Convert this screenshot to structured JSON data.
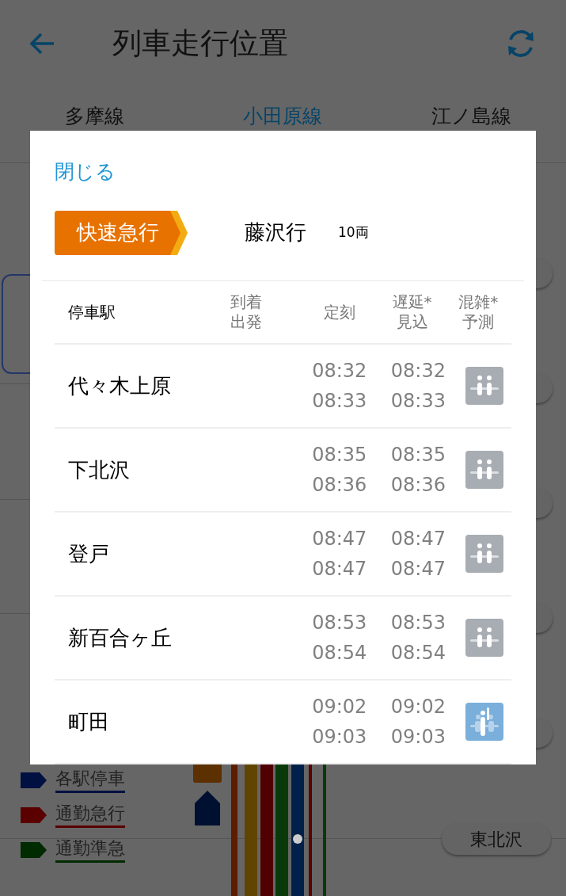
{
  "app_bar": {
    "title": "列車走行位置"
  },
  "tabs": [
    {
      "label": "多摩線",
      "selected": false
    },
    {
      "label": "小田原線",
      "selected": true
    },
    {
      "label": "江ノ島線",
      "selected": false
    }
  ],
  "map": {
    "legend": [
      {
        "label": "各駅停車",
        "color": "#001040"
      },
      {
        "label": "通勤急行",
        "color": "#5a0000"
      },
      {
        "label": "通勤準急",
        "color": "#002a00"
      }
    ],
    "station": "東北沢"
  },
  "dialog": {
    "close": "閉じる",
    "train_type": "快速急行",
    "destination": "藤沢行",
    "cars": "10両",
    "columns": [
      "停車駅",
      "到着出発",
      "定刻",
      "遅延*\n見込",
      "混雑*\n予測"
    ],
    "stops": [
      {
        "station": "代々木上原",
        "scheduled": [
          "08:32",
          "08:33"
        ],
        "expected": [
          "08:32",
          "08:33"
        ],
        "kind": "low"
      },
      {
        "station": "下北沢",
        "scheduled": [
          "08:35",
          "08:36"
        ],
        "expected": [
          "08:35",
          "08:36"
        ],
        "kind": "low"
      },
      {
        "station": "登戸",
        "scheduled": [
          "08:47",
          "08:47"
        ],
        "expected": [
          "08:47",
          "08:47"
        ],
        "kind": "low"
      },
      {
        "station": "新百合ヶ丘",
        "scheduled": [
          "08:53",
          "08:54"
        ],
        "expected": [
          "08:53",
          "08:54"
        ],
        "kind": "low"
      },
      {
        "station": "町田",
        "scheduled": [
          "09:02",
          "09:03"
        ],
        "expected": [
          "09:02",
          "09:03"
        ],
        "kind": "standing"
      }
    ]
  }
}
